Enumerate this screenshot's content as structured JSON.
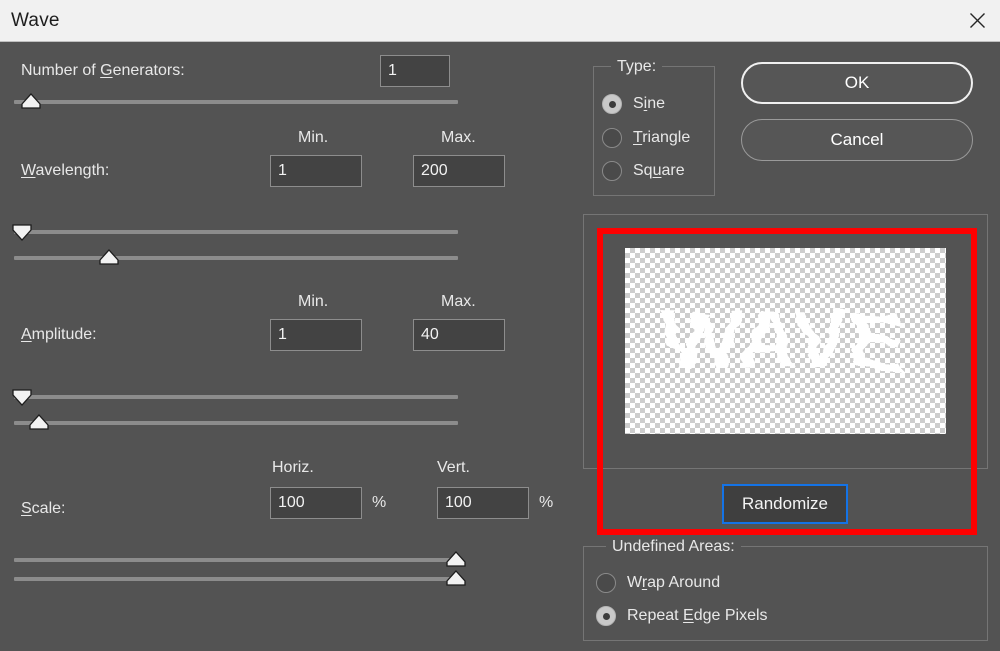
{
  "window": {
    "title": "Wave",
    "close_icon": "close-icon"
  },
  "fields": {
    "generators": {
      "label_pre": "Number of ",
      "label_accel": "G",
      "label_post": "enerators:",
      "value": "1"
    },
    "wavelength": {
      "label_accel": "W",
      "label_post": "avelength:",
      "min_header": "Min.",
      "max_header": "Max.",
      "min_value": "1",
      "max_value": "200"
    },
    "amplitude": {
      "label_accel": "A",
      "label_post": "mplitude:",
      "min_header": "Min.",
      "max_header": "Max.",
      "min_value": "1",
      "max_value": "40"
    },
    "scale": {
      "label_accel": "S",
      "label_post": "cale:",
      "horiz_header": "Horiz.",
      "vert_header": "Vert.",
      "horiz_value": "100",
      "vert_value": "100",
      "horiz_unit": "%",
      "vert_unit": "%"
    }
  },
  "type_group": {
    "legend": "Type:",
    "options": [
      {
        "label_pre": "S",
        "label_accel": "i",
        "label_post": "ne",
        "selected": true
      },
      {
        "label_pre": "",
        "label_accel": "T",
        "label_post": "riangle",
        "selected": false
      },
      {
        "label_pre": "Sq",
        "label_accel": "u",
        "label_post": "are",
        "selected": false
      }
    ]
  },
  "undefined_areas": {
    "legend": "Undefined Areas:",
    "options": [
      {
        "label_pre": "W",
        "label_accel": "r",
        "label_post": "ap Around",
        "selected": false
      },
      {
        "label_pre": "Repeat ",
        "label_accel": "E",
        "label_post": "dge Pixels",
        "selected": true
      }
    ]
  },
  "buttons": {
    "ok": "OK",
    "cancel": "Cancel",
    "randomize": "Randomize"
  },
  "preview": {
    "content_text": "WAVE",
    "description": "wavy distorted WAVE text on transparency checkerboard"
  },
  "colors": {
    "dialog_bg": "#535353",
    "titlebar_bg": "#f1f1f1",
    "field_bg": "#434343",
    "accent_focus": "#1473e6",
    "highlight": "#fe0000",
    "track": "#8c8c8c"
  },
  "slider_positions": {
    "generators": 0,
    "wavelength_min": 0,
    "wavelength_max": 20,
    "amplitude_min": 0,
    "amplitude_max": 4,
    "scale_horiz": 99,
    "scale_vert": 99
  }
}
